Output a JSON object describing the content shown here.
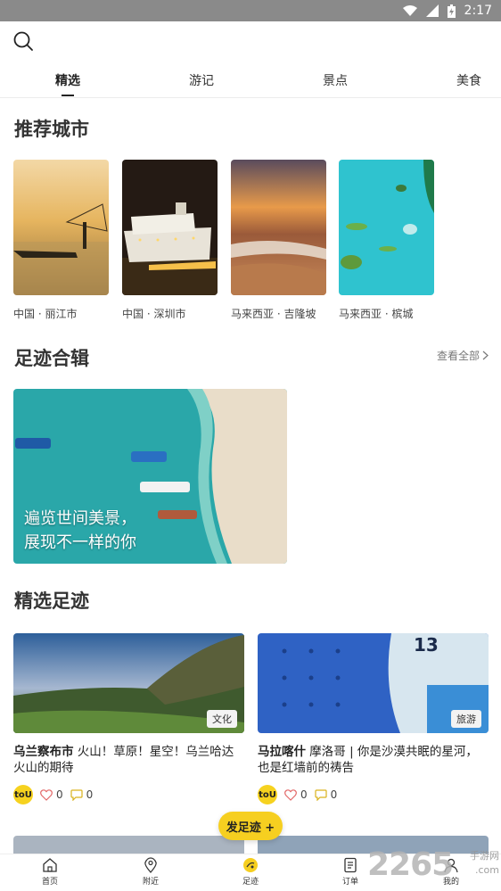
{
  "status_bar": {
    "time": "2:17"
  },
  "tabs": [
    {
      "label": "精选",
      "active": true
    },
    {
      "label": "游记",
      "active": false
    },
    {
      "label": "景点",
      "active": false
    },
    {
      "label": "美食",
      "active": false
    }
  ],
  "recommended": {
    "title": "推荐城市",
    "cities": [
      {
        "label": "中国 · 丽江市"
      },
      {
        "label": "中国 · 深圳市"
      },
      {
        "label": "马来西亚 · 吉隆坡"
      },
      {
        "label": "马来西亚 · 槟城"
      }
    ]
  },
  "collections": {
    "title": "足迹合辑",
    "view_all": "查看全部",
    "banner_line1": "遍览世间美景，",
    "banner_line2": "展现不一样的你"
  },
  "featured": {
    "title": "精选足迹",
    "posts": [
      {
        "tag": "文化",
        "location": "乌兰察布市",
        "text": " 火山！草原！星空！乌兰哈达火山的期待",
        "avatar": "toU",
        "likes": "0",
        "comments": "0"
      },
      {
        "tag": "旅游",
        "location": "马拉喀什",
        "text": " 摩洛哥 | 你是沙漠共眠的星河，也是红墙前的祷告",
        "avatar": "toU",
        "likes": "0",
        "comments": "0"
      }
    ]
  },
  "fab": {
    "label": "发足迹 +"
  },
  "bottom_nav": [
    {
      "label": "首页",
      "icon": "home-icon"
    },
    {
      "label": "附近",
      "icon": "location-pin-icon"
    },
    {
      "label": "足迹",
      "icon": "footprint-icon"
    },
    {
      "label": "订单",
      "icon": "order-icon"
    },
    {
      "label": "我的",
      "icon": "profile-icon"
    }
  ],
  "watermark": {
    "number": "2265",
    "suffix": "手游网",
    "domain": ".com"
  },
  "colors": {
    "accent": "#f6cf20",
    "status_bar": "#8a8a8a"
  }
}
